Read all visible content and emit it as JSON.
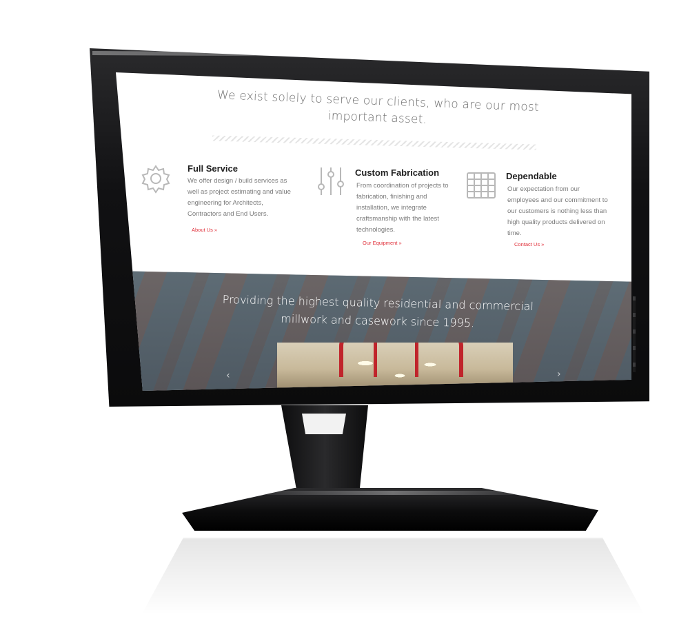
{
  "headline": "We exist solely to serve our clients, who are our most important asset.",
  "features": [
    {
      "icon": "gear-icon",
      "title": "Full Service",
      "text": "We offer design / build services as well as project estimating and value engineering for Architects, Contractors and End Users.",
      "link": "About Us »"
    },
    {
      "icon": "sliders-icon",
      "title": "Custom Fabrication",
      "text": "From coordination of projects to fabrication, finishing and installation, we integrate craftsmanship with the latest technologies.",
      "link": "Our Equipment »"
    },
    {
      "icon": "grid-icon",
      "title": "Dependable",
      "text": "Our expectation from our employees and our commitment to our customers is nothing less than high quality products delivered on time.",
      "link": "Contact Us »"
    }
  ],
  "banner": {
    "text": "Providing the highest quality residential and commercial millwork and casework since 1995."
  },
  "colors": {
    "link": "#e0303a",
    "heading": "#222222",
    "body_text": "#7a7a7a",
    "icon": "#b8b8b8"
  }
}
